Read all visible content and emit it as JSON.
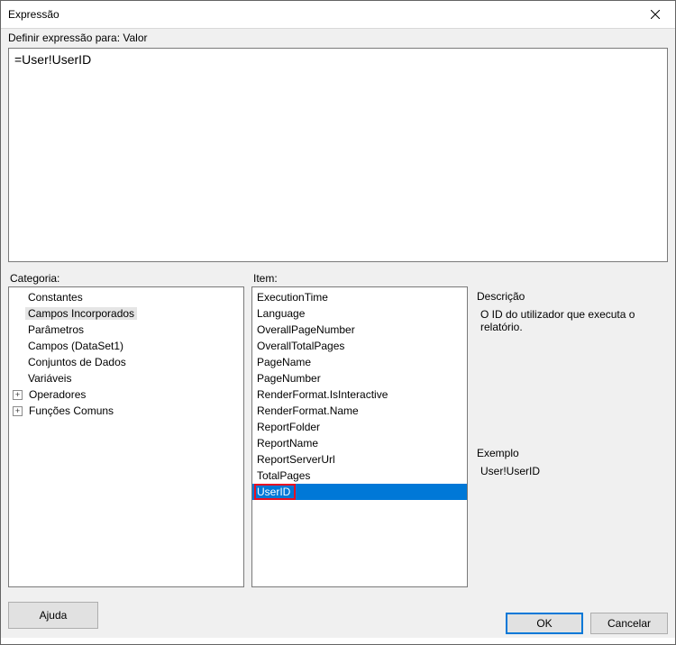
{
  "titlebar": {
    "title": "Expressão"
  },
  "subheader": {
    "text": "Definir expressão para: Valor"
  },
  "expression": {
    "value": "=User!UserID"
  },
  "categoria": {
    "label": "Categoria:",
    "items": [
      {
        "label": "Constantes",
        "expandable": false,
        "indent": 1,
        "selected": false
      },
      {
        "label": "Campos Incorporados",
        "expandable": false,
        "indent": 1,
        "selected": true
      },
      {
        "label": "Parâmetros",
        "expandable": false,
        "indent": 1,
        "selected": false
      },
      {
        "label": "Campos (DataSet1)",
        "expandable": false,
        "indent": 1,
        "selected": false
      },
      {
        "label": "Conjuntos de Dados",
        "expandable": false,
        "indent": 1,
        "selected": false
      },
      {
        "label": "Variáveis",
        "expandable": false,
        "indent": 1,
        "selected": false
      },
      {
        "label": "Operadores",
        "expandable": true,
        "expanded": false,
        "indent": 0,
        "selected": false
      },
      {
        "label": "Funções Comuns",
        "expandable": true,
        "expanded": false,
        "indent": 0,
        "selected": false
      }
    ]
  },
  "item": {
    "label": "Item:",
    "items": [
      {
        "label": "ExecutionTime",
        "selected": false
      },
      {
        "label": "Language",
        "selected": false
      },
      {
        "label": "OverallPageNumber",
        "selected": false
      },
      {
        "label": "OverallTotalPages",
        "selected": false
      },
      {
        "label": "PageName",
        "selected": false
      },
      {
        "label": "PageNumber",
        "selected": false
      },
      {
        "label": "RenderFormat.IsInteractive",
        "selected": false
      },
      {
        "label": "RenderFormat.Name",
        "selected": false
      },
      {
        "label": "ReportFolder",
        "selected": false
      },
      {
        "label": "ReportName",
        "selected": false
      },
      {
        "label": "ReportServerUrl",
        "selected": false
      },
      {
        "label": "TotalPages",
        "selected": false
      },
      {
        "label": "UserID",
        "selected": true,
        "highlight": true
      }
    ]
  },
  "descricao": {
    "label": "Descrição",
    "text": "O ID do utilizador que executa o relatório."
  },
  "exemplo": {
    "label": "Exemplo",
    "text": "User!UserID"
  },
  "buttons": {
    "help": "Ajuda",
    "ok": "OK",
    "cancel": "Cancelar"
  }
}
